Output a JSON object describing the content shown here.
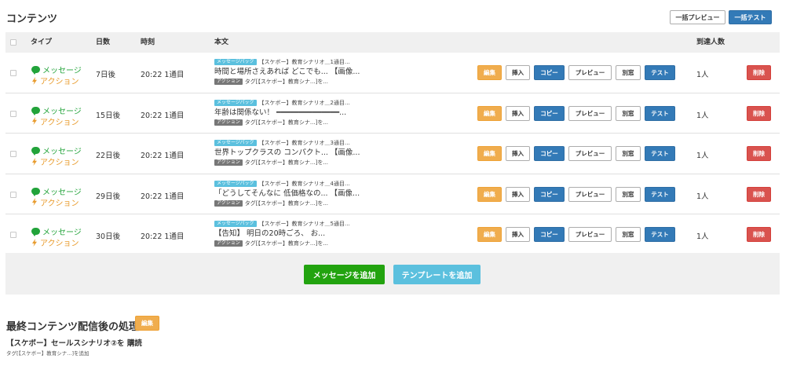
{
  "header": {
    "title": "コンテンツ",
    "bulk_preview_label": "一括プレビュー",
    "bulk_test_label": "一括テスト"
  },
  "table": {
    "columns": {
      "type": "タイプ",
      "days": "日数",
      "time": "時刻",
      "body": "本文",
      "reach": "到達人数"
    },
    "type_labels": {
      "message": "メッセージ",
      "action": "アクション"
    },
    "tag_labels": {
      "message_pack": "メッセージパック",
      "action": "アクション"
    },
    "button_labels": {
      "edit": "編集",
      "insert": "挿入",
      "copy": "コピー",
      "preview": "プレビュー",
      "window": "別窓",
      "test": "テスト",
      "delete": "削除"
    },
    "rows": [
      {
        "days": "7日後",
        "time": "20:22 1通目",
        "pack_title": "【スケボー】教育シナリオ＿1通目...",
        "preview": "時間と場所さえあれば どこでも... 【画像...",
        "action_text": "タグ[【スケボー】教育シナ...]を...",
        "reach": "1人"
      },
      {
        "days": "15日後",
        "time": "20:22 1通目",
        "pack_title": "【スケボー】教育シナリオ＿2通目...",
        "preview": "年齢は関係ない！ ━━━━━━━━━━━━━━...",
        "action_text": "タグ[【スケボー】教育シナ...]を...",
        "reach": "1人"
      },
      {
        "days": "22日後",
        "time": "20:22 1通目",
        "pack_title": "【スケボー】教育シナリオ＿3通目...",
        "preview": "世界トップクラスの コンパクト... 【画像...",
        "action_text": "タグ[【スケボー】教育シナ...]を...",
        "reach": "1人"
      },
      {
        "days": "29日後",
        "time": "20:22 1通目",
        "pack_title": "【スケボー】教育シナリオ＿4通目...",
        "preview": "「どうしてそんなに 低価格なの... 【画像...",
        "action_text": "タグ[【スケボー】教育シナ...]を...",
        "reach": "1人"
      },
      {
        "days": "30日後",
        "time": "20:22 1通目",
        "pack_title": "【スケボー】教育シナリオ＿5通目...",
        "preview": "【告知】 明日の20時ごろ、 お...",
        "action_text": "タグ[【スケボー】教育シナ...]を...",
        "reach": "1人"
      }
    ]
  },
  "add": {
    "add_message_label": "メッセージを追加",
    "add_template_label": "テンプレートを追加"
  },
  "final": {
    "title": "最終コンテンツ配信後の処理",
    "edit_label": "編集",
    "scenario_line": "【スケボー】セールスシナリオ②を 購読",
    "tag_line": "タグ[【スケボー】教育シナ...]を追加"
  },
  "colors": {
    "primary": "#337ab7",
    "warning": "#f0ad4e",
    "danger": "#d9534f",
    "success": "#22a30f",
    "info": "#5bc0de",
    "message_type": "#22a33a",
    "action_type": "#e89b2c"
  },
  "icons": {
    "message": "chat-bubble-icon",
    "action": "lightning-bolt-icon"
  }
}
